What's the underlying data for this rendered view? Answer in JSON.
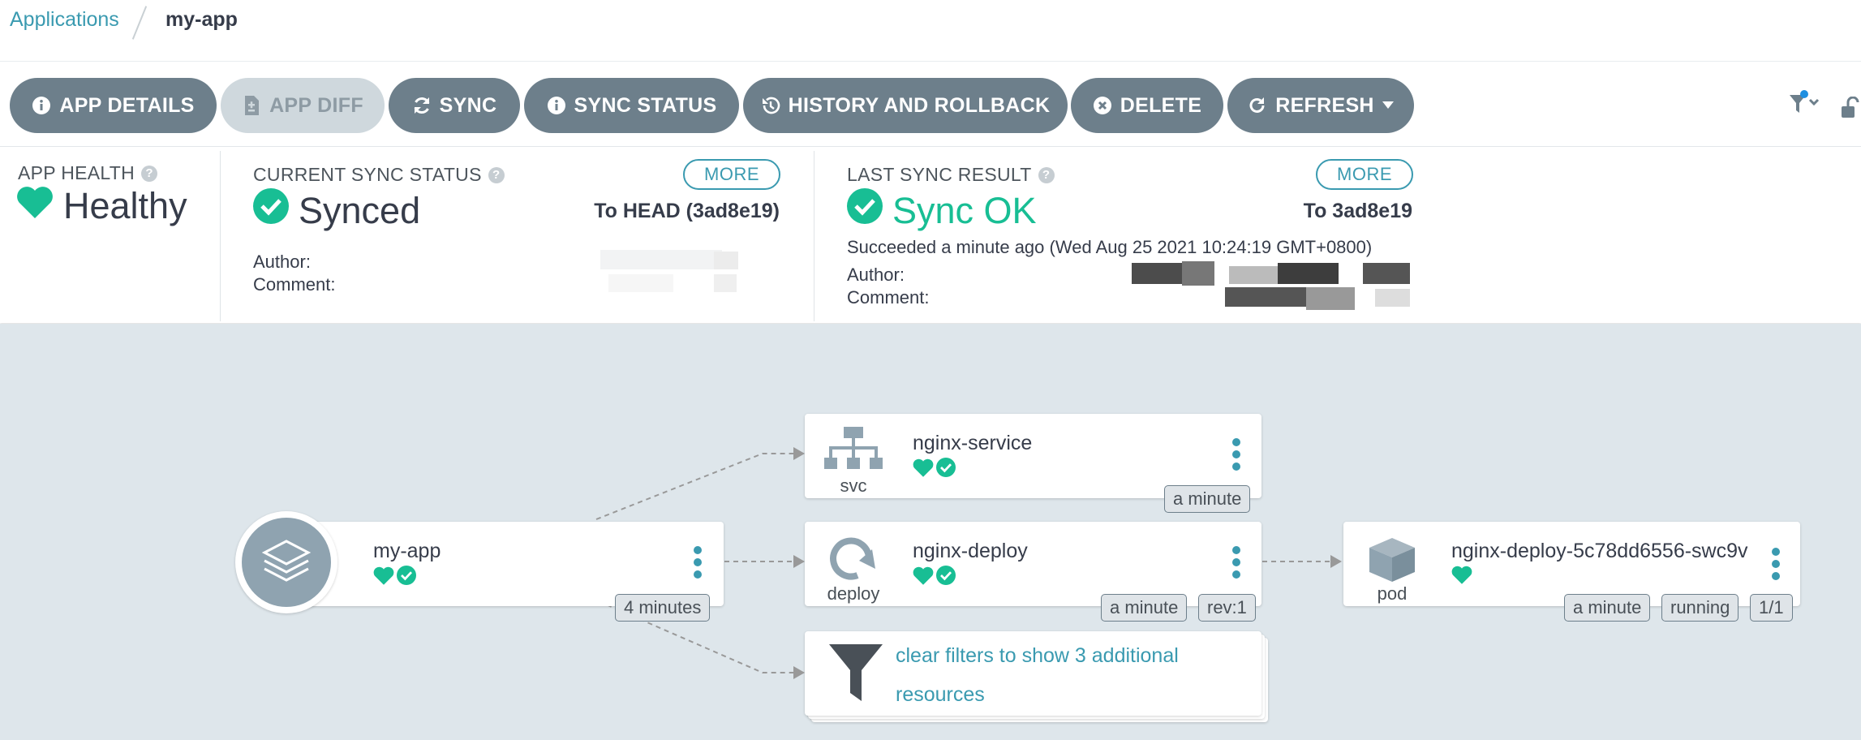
{
  "breadcrumb": {
    "root": "Applications",
    "current": "my-app"
  },
  "toolbar": {
    "buttons": [
      {
        "label": "APP DETAILS",
        "icon": "info-icon"
      },
      {
        "label": "APP DIFF",
        "icon": "file-diff-icon",
        "disabled": true
      },
      {
        "label": "SYNC",
        "icon": "sync-icon"
      },
      {
        "label": "SYNC STATUS",
        "icon": "info-icon"
      },
      {
        "label": "HISTORY AND ROLLBACK",
        "icon": "history-icon"
      },
      {
        "label": "DELETE",
        "icon": "times-circle-icon"
      },
      {
        "label": "REFRESH",
        "icon": "redo-icon",
        "dropdown": true
      }
    ]
  },
  "status": {
    "health": {
      "label": "APP HEALTH",
      "value": "Healthy",
      "color": "#18be94"
    },
    "current_sync": {
      "label": "CURRENT SYNC STATUS",
      "value": "Synced",
      "more": "MORE",
      "revision": "To HEAD (3ad8e19)",
      "author_label": "Author:",
      "comment_label": "Comment:"
    },
    "last_sync": {
      "label": "LAST SYNC RESULT",
      "value": "Sync OK",
      "more": "MORE",
      "revision": "To 3ad8e19",
      "detail": "Succeeded a minute ago (Wed Aug 25 2021 10:24:19 GMT+0800)",
      "author_label": "Author:",
      "comment_label": "Comment:"
    }
  },
  "graph": {
    "app_node": {
      "name": "my-app",
      "age": "4 minutes"
    },
    "service_node": {
      "name": "nginx-service",
      "kind": "svc",
      "age": "a minute"
    },
    "deploy_node": {
      "name": "nginx-deploy",
      "kind": "deploy",
      "age": "a minute",
      "rev": "rev:1"
    },
    "pod_node": {
      "name": "nginx-deploy-5c78dd6556-swc9v",
      "kind": "pod",
      "age": "a minute",
      "status": "running",
      "ready": "1/1"
    },
    "filter_node": {
      "line1": "clear filters to show 3 additional",
      "line2": "resources"
    }
  },
  "colors": {
    "accent": "#3a9ab0",
    "healthy": "#18be94",
    "button": "#6d7f8b",
    "graph_bg": "#dee6eb"
  }
}
